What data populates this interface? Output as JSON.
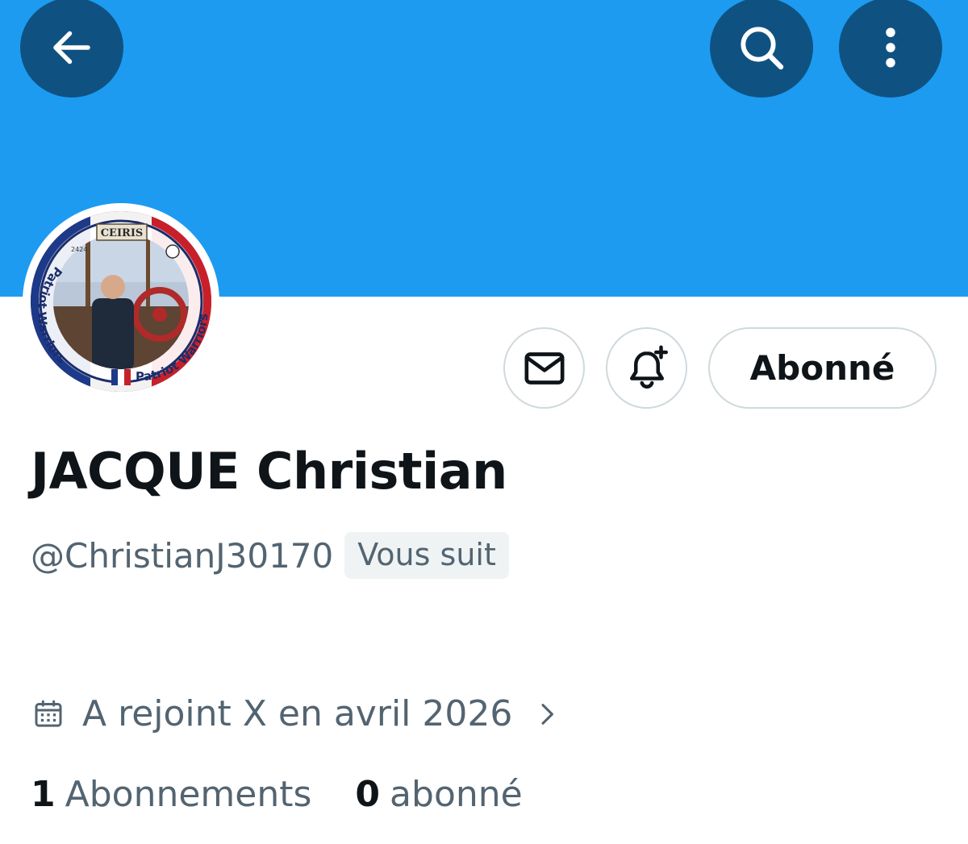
{
  "header": {
    "back_icon": "arrow-left-icon",
    "search_icon": "search-icon",
    "more_icon": "more-vertical-icon",
    "banner_color": "#1d9bf0",
    "button_color": "#0f5282"
  },
  "avatar": {
    "badge_top": "CEIRIS",
    "badge_number": "2424",
    "ring_text_left": "Patriot Warriors",
    "ring_text_right": "Patriot Warriors"
  },
  "actions": {
    "message_icon": "envelope-icon",
    "notify_icon": "bell-plus-icon",
    "follow_label": "Abonné"
  },
  "profile": {
    "display_name": "JACQUE Christian",
    "handle": "@ChristianJ30170",
    "follows_you": "Vous suit",
    "joined": "A rejoint X en avril 2026",
    "joined_icon": "calendar-icon",
    "following_count": "1",
    "following_label": "Abonnements",
    "followers_count": "0",
    "followers_label": "abonné"
  },
  "colors": {
    "primary_text": "#0f1419",
    "secondary_text": "#536471",
    "border": "#cfd9de"
  }
}
